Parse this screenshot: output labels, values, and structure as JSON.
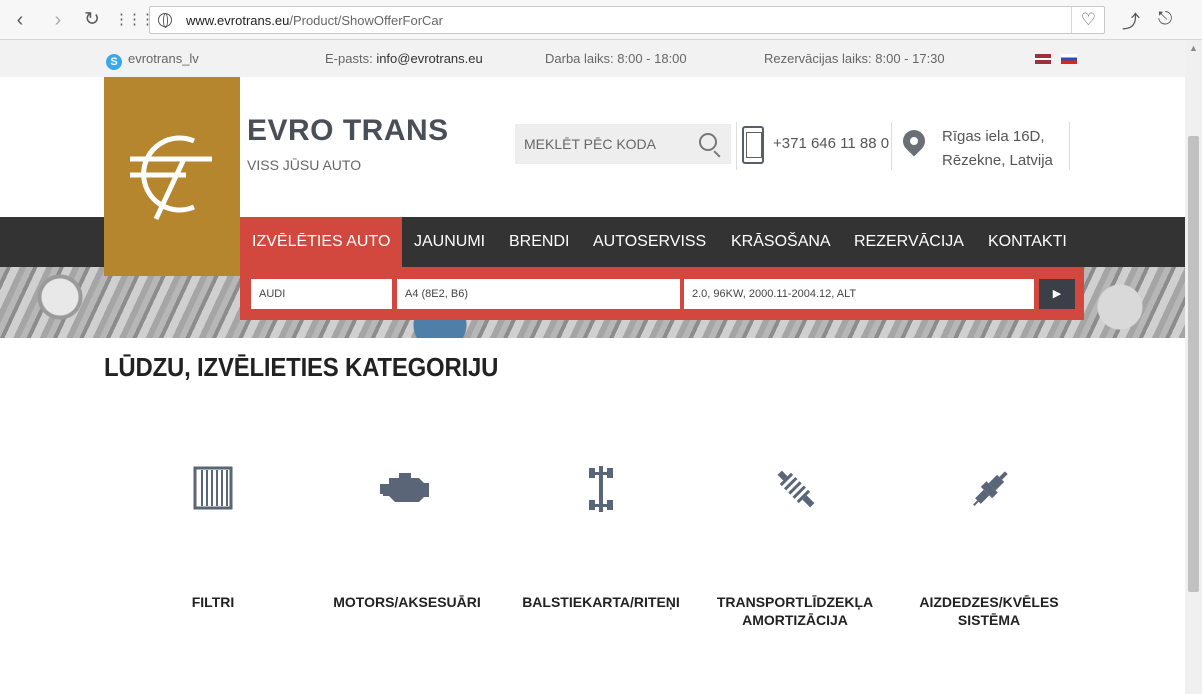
{
  "browser": {
    "url_host": "www.evrotrans.eu",
    "url_path": "/Product/ShowOfferForCar",
    "icons": [
      "back-icon",
      "forward-icon",
      "reload-icon",
      "apps-grid-icon",
      "globe-icon",
      "heart-icon",
      "extension-icon",
      "download-icon"
    ]
  },
  "topbar": {
    "skype": "evrotrans_lv",
    "email_label": "E-pasts:",
    "email": "info@evrotrans.eu",
    "hours": "Darba laiks: 8:00 - 18:00",
    "reservation_hours": "Rezervācijas laiks: 8:00 - 17:30"
  },
  "header": {
    "brand": "EVRO TRANS",
    "tagline": "VISS JŪSU AUTO",
    "search_placeholder": "MEKLĒT PĒC KODA",
    "phone": "+371 646 11 88 0",
    "address_line1": "Rīgas iela 16D,",
    "address_line2": "Rēzekne, Latvija",
    "brand_color": "#b6862f",
    "accent_color": "#d2473e"
  },
  "nav": {
    "items": [
      "IZVĒLĒTIES AUTO",
      "JAUNUMI",
      "BRENDI",
      "AUTOSERVISS",
      "KRĀSOŠANA",
      "REZERVĀCIJA",
      "KONTAKTI"
    ]
  },
  "car_selector": {
    "make": "AUDI",
    "model": "A4 (8E2, B6)",
    "engine": "2.0, 96KW, 2000.11-2004.12, ALT"
  },
  "main": {
    "heading": "LŪDZU, IZVĒLIETIES KATEGORIJU",
    "categories": [
      {
        "label": "FILTRI",
        "icon": "air-filter-icon"
      },
      {
        "label": "MOTORS/AKSESUĀRI",
        "icon": "engine-icon"
      },
      {
        "label": "BALSTIEKARTA/RITEŅI",
        "icon": "chassis-axle-icon"
      },
      {
        "label": "TRANSPORTLĪDZEKĻA AMORTIZĀCIJA",
        "icon": "shock-absorber-icon"
      },
      {
        "label": "AIZDEDZES/KVĒLES SISTĒMA",
        "icon": "spark-plug-icon"
      }
    ]
  }
}
